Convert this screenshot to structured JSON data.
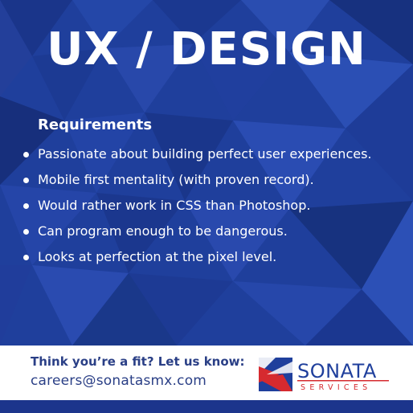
{
  "title": "UX / DESIGN",
  "requirements": {
    "heading": "Requirements",
    "items": [
      "Passionate about building perfect user experiences.",
      "Mobile first mentality (with proven record).",
      "Would rather work in CSS than Photoshop.",
      "Can program enough to be dangerous.",
      "Looks at perfection at the pixel level."
    ]
  },
  "footer": {
    "cta": "Think you’re a fit? Let us know:",
    "email": "careers@sonatasmx.com",
    "logo": {
      "name": "SONATA",
      "sub": "SERVICES"
    }
  },
  "colors": {
    "background": "#1f3f9c",
    "footer_text": "#2a3f86",
    "logo_red": "#d62a2f",
    "logo_blue": "#1f3f9c"
  }
}
